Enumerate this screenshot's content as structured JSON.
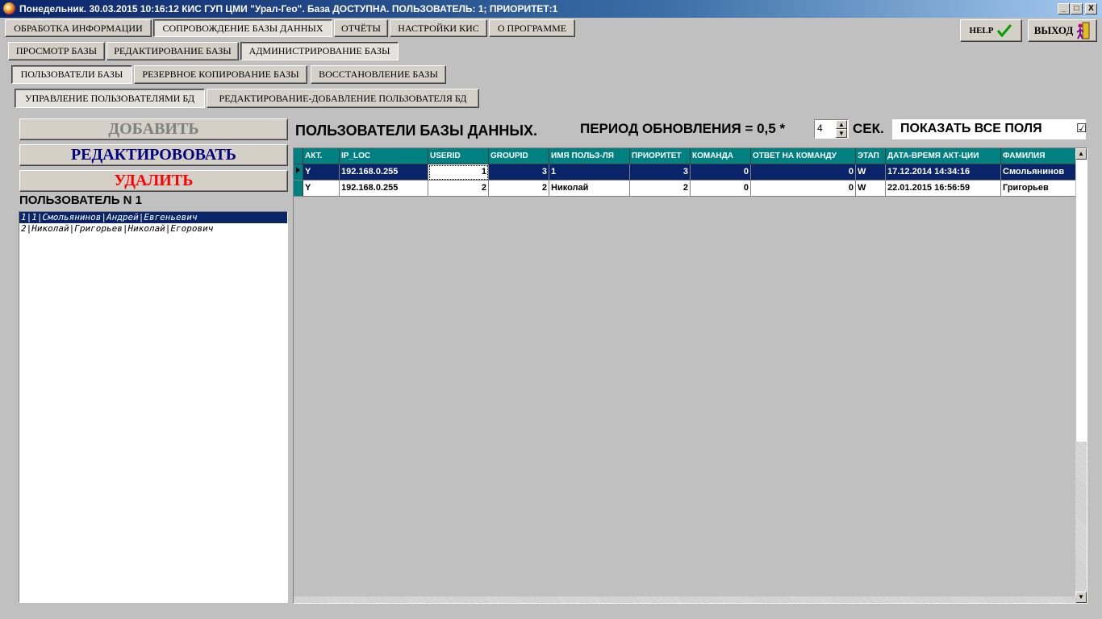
{
  "window": {
    "title": "Понедельник. 30.03.2015 10:16:12 КИС ГУП ЦМИ \"Урал-Гео\". База ДОСТУПНА. ПОЛЬЗОВАТЕЛЬ: 1; ПРИОРИТЕТ:1",
    "minimize": "_",
    "maximize": "□",
    "close": "X"
  },
  "menu1": [
    {
      "label": "ОБРАБОТКА ИНФОРМАЦИИ",
      "active": false
    },
    {
      "label": "СОПРОВОЖДЕНИЕ БАЗЫ ДАННЫХ",
      "active": true
    },
    {
      "label": "ОТЧЁТЫ",
      "active": false
    },
    {
      "label": "НАСТРОЙКИ КИС",
      "active": false
    },
    {
      "label": "О ПРОГРАММЕ",
      "active": false
    }
  ],
  "menu2": [
    {
      "label": "ПРОСМОТР БАЗЫ",
      "active": false
    },
    {
      "label": "РЕДАКТИРОВАНИЕ БАЗЫ",
      "active": false
    },
    {
      "label": "АДМИНИСТРИРОВАНИЕ БАЗЫ",
      "active": true
    }
  ],
  "menu3": [
    {
      "label": "ПОЛЬЗОВАТЕЛИ БАЗЫ",
      "active": true
    },
    {
      "label": "РЕЗЕРВНОЕ КОПИРОВАНИЕ БАЗЫ",
      "active": false
    },
    {
      "label": "ВОССТАНОВЛЕНИЕ БАЗЫ",
      "active": false
    }
  ],
  "menu4": [
    {
      "label": "УПРАВЛЕНИЕ ПОЛЬЗОВАТЕЛЯМИ БД",
      "active": true
    },
    {
      "label": "РЕДАКТИРОВАНИЕ-ДОБАВЛЕНИЕ  ПОЛЬЗОВАТЕЛЯ БД",
      "active": false
    }
  ],
  "help_label": "HELP",
  "exit_label": "ВЫХОД",
  "actions": {
    "add": "ДОБАВИТЬ",
    "edit": "РЕДАКТИРОВОВАТЬ",
    "delete": "УДАЛИТЬ",
    "colors": {
      "add": "#808080",
      "edit": "#000080",
      "delete": "#ff0000"
    }
  },
  "user_label": "ПОЛЬЗОВАТЕЛЬ N 1",
  "user_list": [
    "1|1|Смольянинов|Андрей|Евгеньевич",
    "2|Николай|Григорьев|Николай|Егорович"
  ],
  "user_list_selected": 0,
  "section_title": "ПОЛЬЗОВАТЕЛИ БАЗЫ ДАННЫХ.",
  "period": {
    "label": "ПЕРИОД ОБНОВЛЕНИЯ = 0,5 *",
    "value": "4",
    "unit": "СЕК."
  },
  "show_all_fields": {
    "label": "ПОКАЗАТЬ ВСЕ ПОЛЯ",
    "checked": true,
    "mark": "☑"
  },
  "grid": {
    "columns": [
      "АКТ.",
      "IP_LOC",
      "USERID",
      "GROUPID",
      "ИМЯ ПОЛЬЗ-ЛЯ",
      "ПРИОРИТЕТ",
      "КОМАНДА",
      "ОТВЕТ НА КОМАНДУ",
      "ЭТАП",
      "ДАТА-ВРЕМЯ АКТ-ЦИИ",
      "ФАМИЛИЯ"
    ],
    "rows": [
      [
        "Y",
        "192.168.0.255",
        "1",
        "3",
        "1",
        "3",
        "0",
        "0",
        "W",
        "17.12.2014 14:34:16",
        "Смольянинов"
      ],
      [
        "Y",
        "192.168.0.255",
        "2",
        "2",
        "Николай",
        "2",
        "0",
        "0",
        "W",
        "22.01.2015 16:56:59",
        "Григорьев"
      ]
    ],
    "selected_row": 0
  }
}
